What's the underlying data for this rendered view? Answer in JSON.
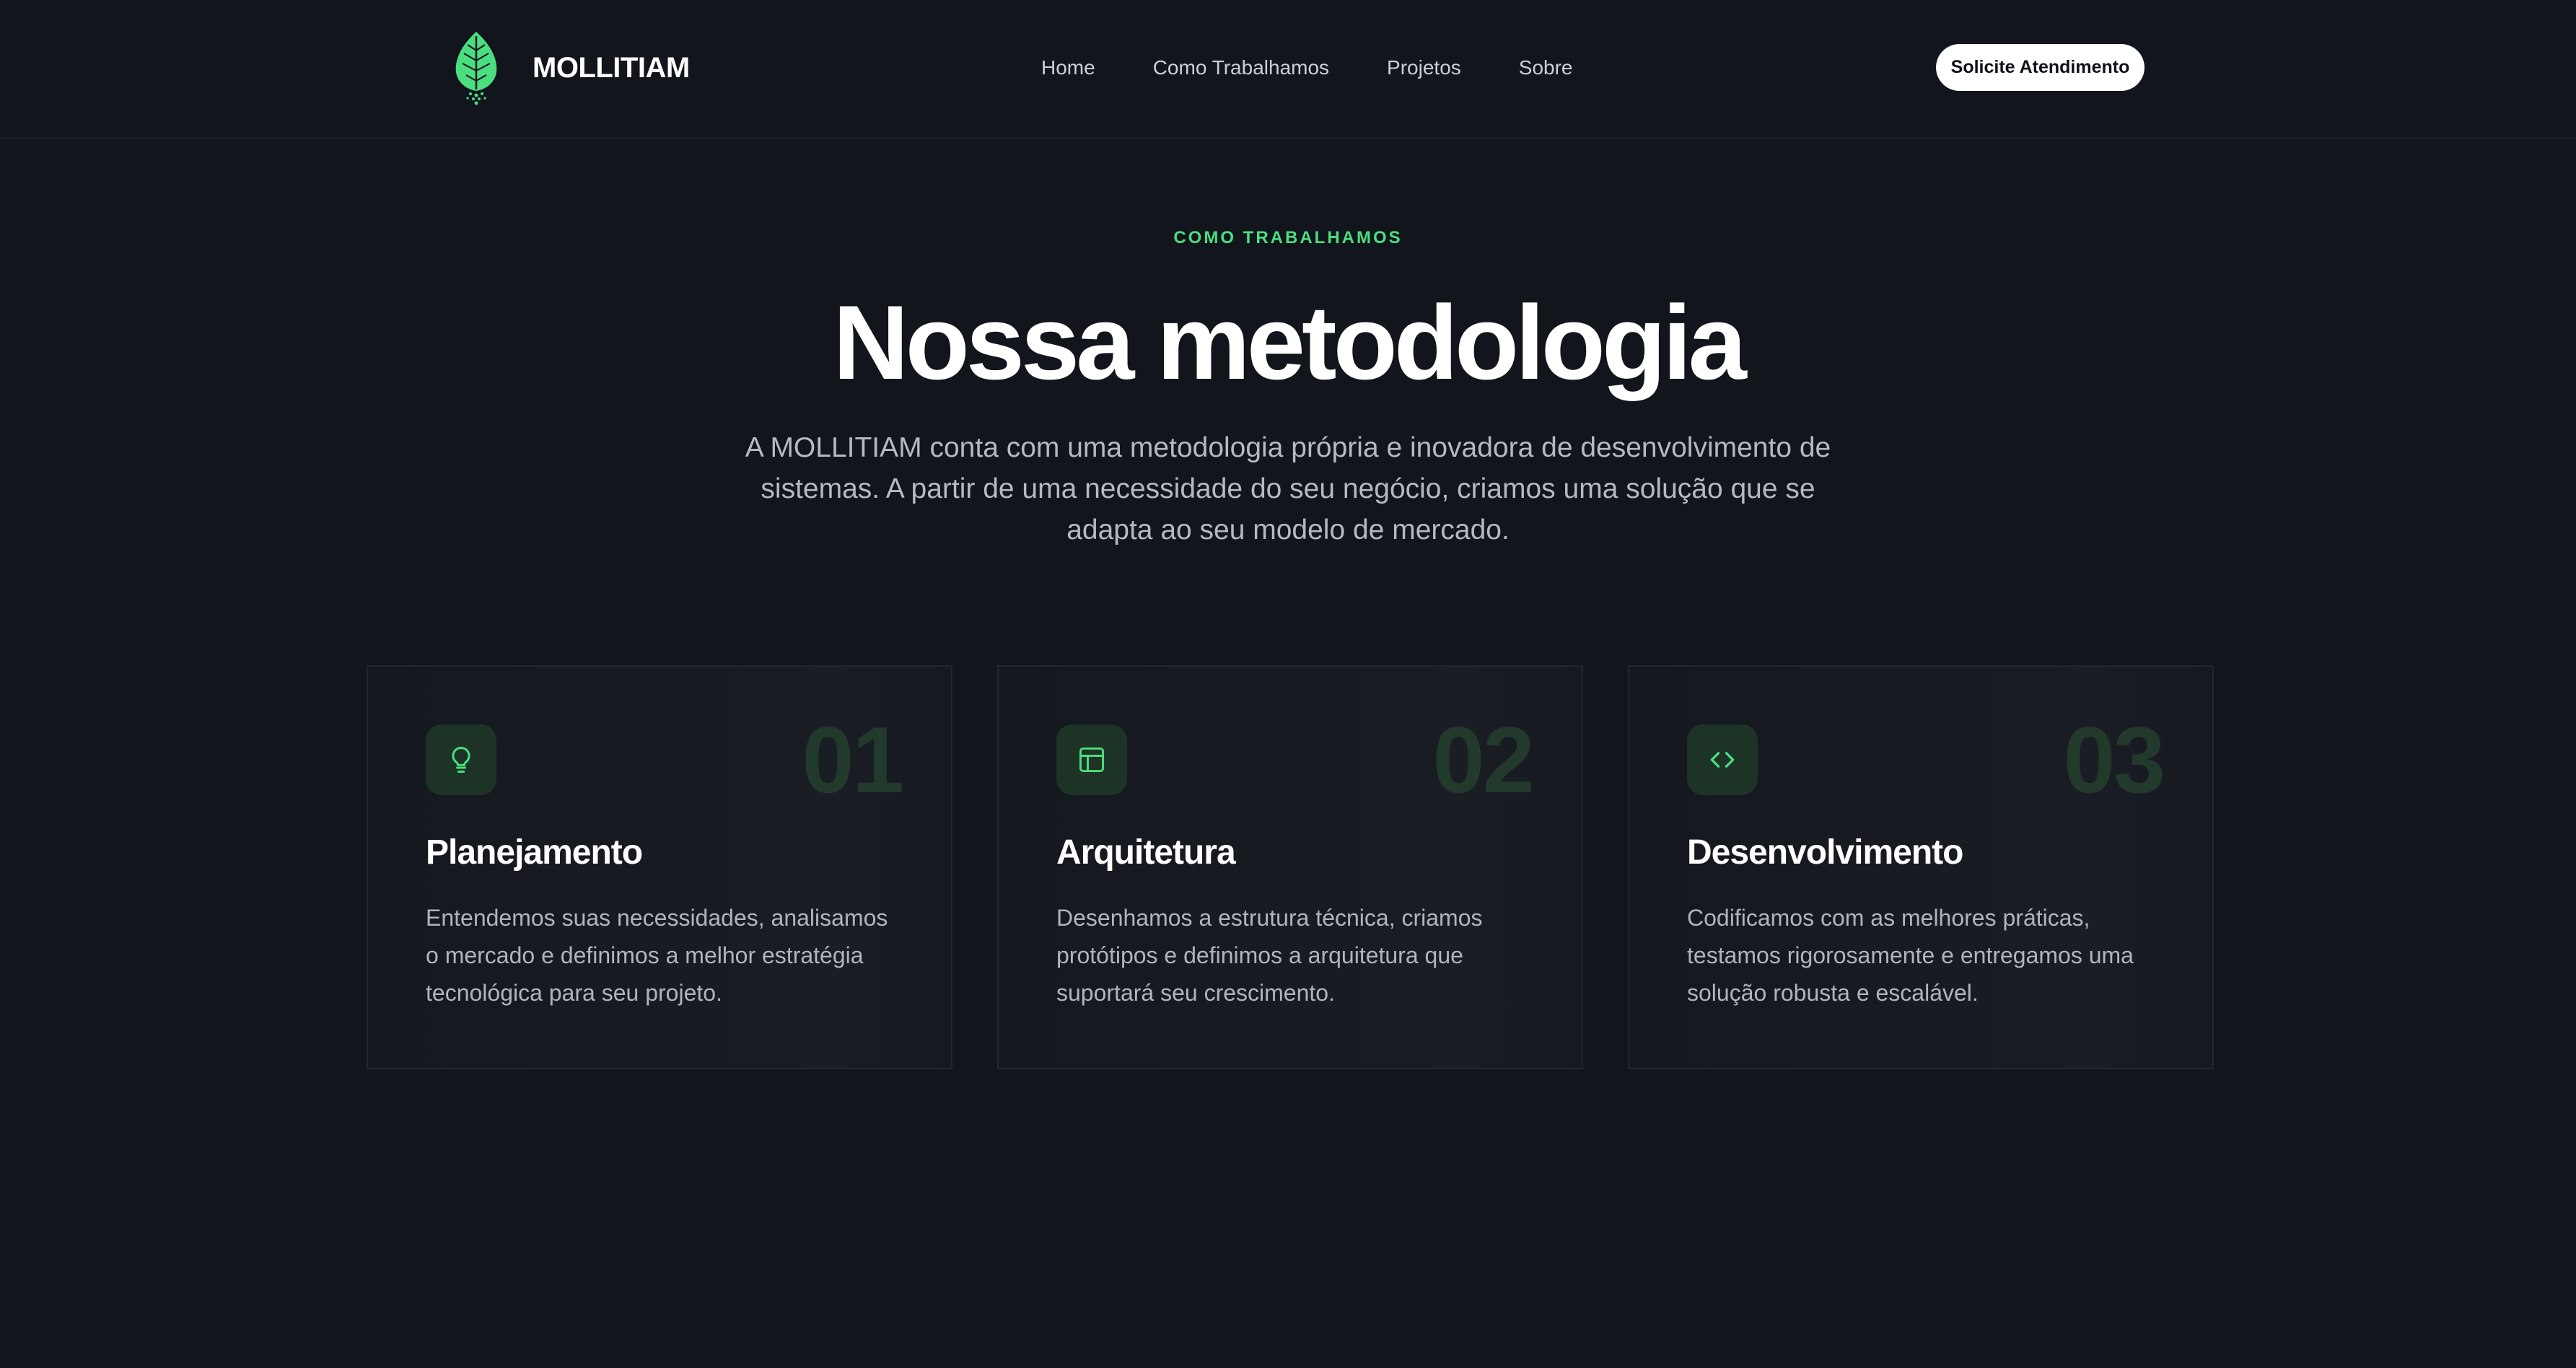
{
  "brand": {
    "name": "MOLLITIAM",
    "logo_icon": "leaf-icon",
    "accent_color": "#4ade80"
  },
  "nav": {
    "items": [
      {
        "label": "Home"
      },
      {
        "label": "Como Trabalhamos"
      },
      {
        "label": "Projetos"
      },
      {
        "label": "Sobre"
      }
    ],
    "cta_label": "Solicite Atendimento"
  },
  "hero": {
    "eyebrow": "COMO TRABALHAMOS",
    "title": "Nossa metodologia",
    "description": "A MOLLITIAM conta com uma metodologia própria e inovadora de desenvolvimento de sistemas. A partir de uma necessidade do seu negócio, criamos uma solução que se adapta ao seu modelo de mercado."
  },
  "cards": [
    {
      "number": "01",
      "icon": "lightbulb-icon",
      "title": "Planejamento",
      "text": "Entendemos suas necessidades, analisamos o mercado e definimos a melhor estratégia tecnológica para seu projeto."
    },
    {
      "number": "02",
      "icon": "layout-icon",
      "title": "Arquitetura",
      "text": "Desenhamos a estrutura técnica, criamos protótipos e definimos a arquitetura que suportará seu crescimento."
    },
    {
      "number": "03",
      "icon": "code-icon",
      "title": "Desenvolvimento",
      "text": "Codificamos com as melhores práticas, testamos rigorosamente e entregamos uma solução robusta e escalável."
    }
  ]
}
